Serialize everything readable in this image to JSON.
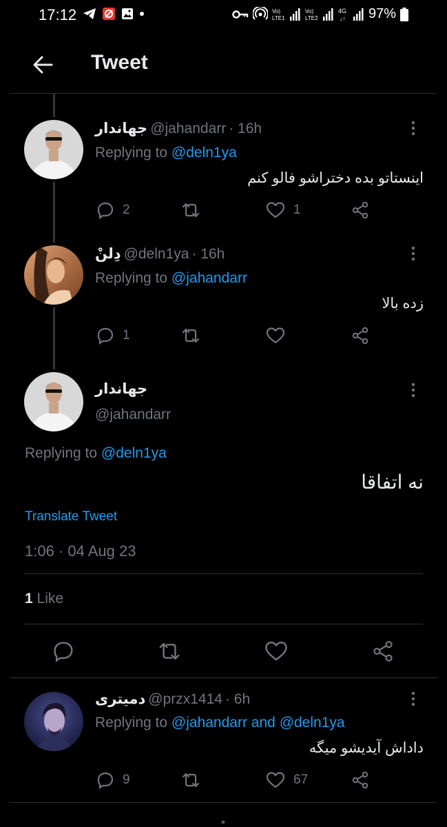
{
  "status_bar": {
    "time": "17:12",
    "battery": "97%",
    "net1": "LTE1",
    "net2": "LTE2",
    "net_type": "4G"
  },
  "header": {
    "title": "Tweet"
  },
  "tweets": [
    {
      "name": "جهاندار",
      "handle": "@jahandarr",
      "time": "· 16h",
      "replying_prefix": "Replying to",
      "replying_to": "@deln1ya",
      "text": "اینستاتو بده دختراشو فالو کنم",
      "replies": "2",
      "retweets": "",
      "likes": "1"
    },
    {
      "name": "دِلنْ",
      "handle": "@deln1ya",
      "time": "· 16h",
      "replying_prefix": "Replying to",
      "replying_to": "@jahandarr",
      "text": "زده بالا",
      "replies": "1",
      "retweets": "",
      "likes": ""
    }
  ],
  "main_tweet": {
    "name": "جهاندار",
    "handle": "@jahandarr",
    "replying_prefix": "Replying to",
    "replying_to": "@deln1ya",
    "text": "نه اتفاقا",
    "translate": "Translate Tweet",
    "timestamp": "1:06 · 04 Aug 23",
    "like_count": "1",
    "like_label": "Like"
  },
  "reply_tweet": {
    "name": "دمیتری",
    "handle": "@przx1414",
    "time": "· 6h",
    "replying_prefix": "Replying to",
    "replying_to_1": "@jahandarr",
    "and": "and",
    "replying_to_2": "@deln1ya",
    "text": "داداش آیدیشو میگه",
    "replies": "9",
    "retweets": "",
    "likes": "67"
  },
  "colors": {
    "background": "#000000",
    "text": "#e7e9ea",
    "muted": "#71767b",
    "link": "#1d9bf0",
    "divider": "#2f3336"
  }
}
